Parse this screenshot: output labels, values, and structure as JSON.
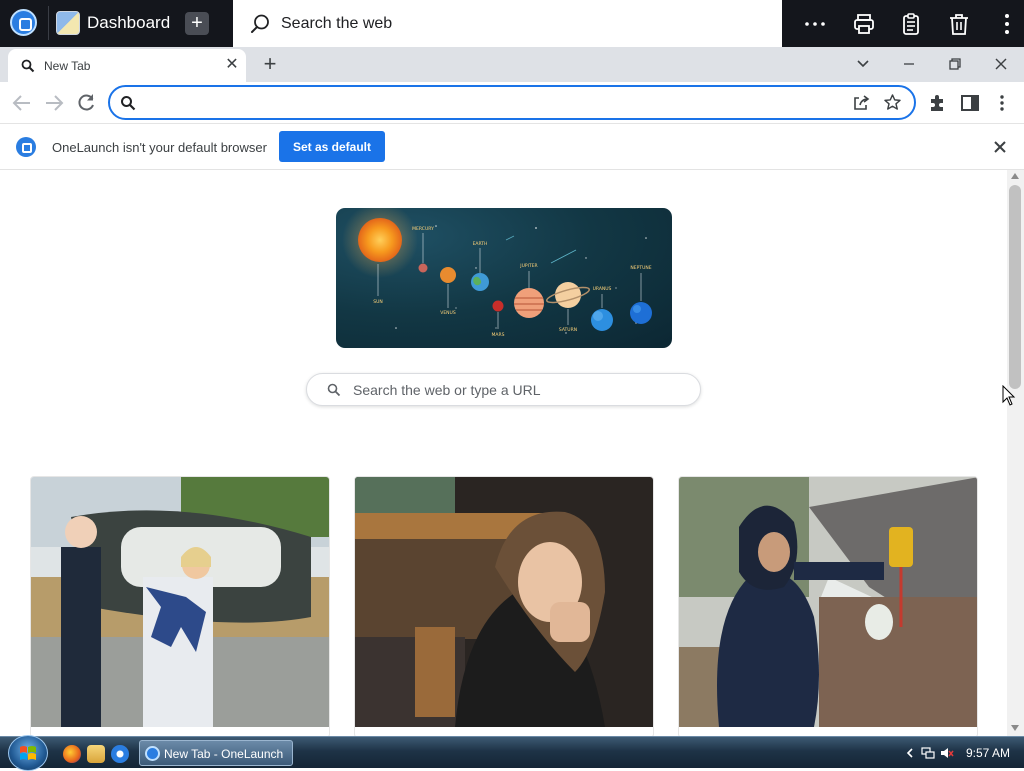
{
  "onelaunch_bar": {
    "dashboard_label": "Dashboard",
    "search_placeholder": "Search the web"
  },
  "tabs": [
    {
      "title": "New Tab"
    }
  ],
  "omnibox": {
    "value": ""
  },
  "infobar": {
    "message": "OneLaunch isn't your default browser",
    "button_label": "Set as default"
  },
  "new_tab_page": {
    "search_placeholder": "Search the web or type a URL",
    "hero_labels": {
      "sun": "SUN",
      "mercury": "MERCURY",
      "venus": "VENUS",
      "earth": "EARTH",
      "mars": "MARS",
      "jupiter": "JUPITER",
      "saturn": "SATURN",
      "uranus": "URANUS",
      "neptune": "NEPTUNE"
    }
  },
  "taskbar": {
    "active_window": "New Tab - OneLaunch",
    "clock": "9:57 AM"
  },
  "colors": {
    "accent": "#1a73e8",
    "topbar_bg": "#14161c",
    "tabstrip_bg": "#dee1e6"
  }
}
